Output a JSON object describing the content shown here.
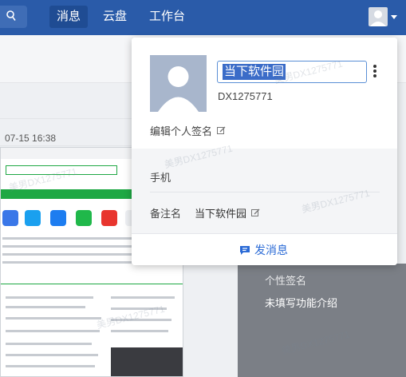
{
  "topbar": {
    "tabs": [
      {
        "label": "消息",
        "active": true
      },
      {
        "label": "云盘",
        "active": false
      },
      {
        "label": "工作台",
        "active": false
      }
    ]
  },
  "background": {
    "timestamp": "07-15 16:38",
    "panel_labels": [
      "个性签名",
      "未填写功能介绍"
    ]
  },
  "profile_card": {
    "name_value": "当下软件园",
    "user_id": "DX1275771",
    "signature_label": "编辑个人签名",
    "phone_label": "手机",
    "remark_label": "备注名",
    "remark_value": "当下软件园",
    "send_button": "发消息"
  },
  "watermark_text": "美男DX1275771",
  "colors": {
    "topbar": "#2a5ba9",
    "accent": "#2a6ad6",
    "selection": "#3b6cc8"
  }
}
